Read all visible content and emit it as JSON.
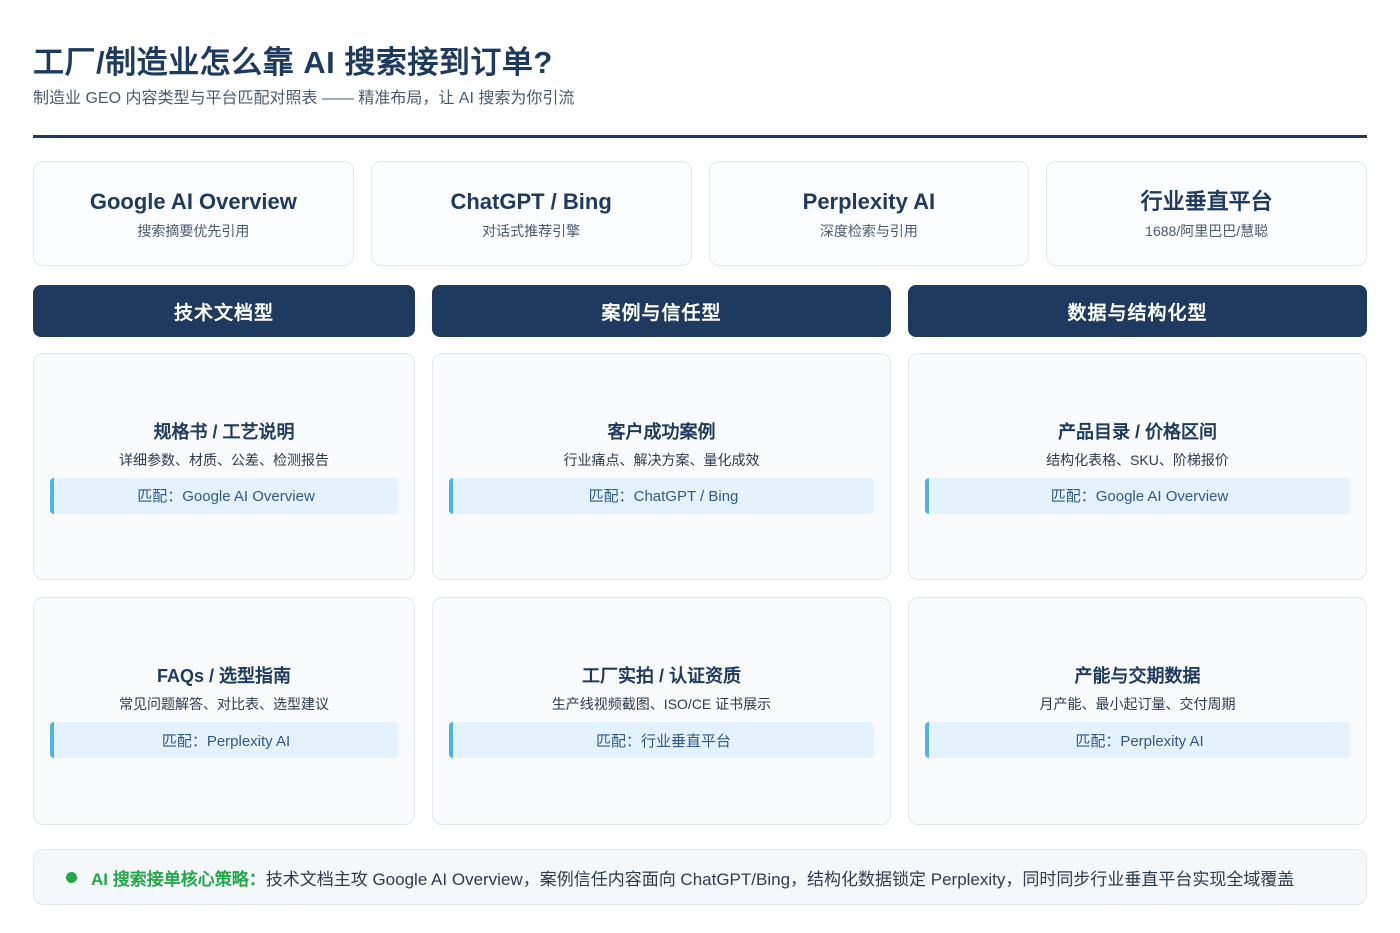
{
  "header": {
    "title": "工厂/制造业怎么靠 AI 搜索接到订单?",
    "subtitle": "制造业 GEO 内容类型与平台匹配对照表 —— 精准布局，让 AI 搜索为你引流"
  },
  "platforms": [
    {
      "name": "Google AI Overview",
      "desc": "搜索摘要优先引用"
    },
    {
      "name": "ChatGPT / Bing",
      "desc": "对话式推荐引擎"
    },
    {
      "name": "Perplexity AI",
      "desc": "深度检索与引用"
    },
    {
      "name": "行业垂直平台",
      "desc": "1688/阿里巴巴/慧聪"
    }
  ],
  "columns": [
    {
      "head": "技术文档型",
      "cards": [
        {
          "title": "规格书 / 工艺说明",
          "desc": "详细参数、材质、公差、检测报告",
          "match": "匹配：Google AI Overview"
        },
        {
          "title": "FAQs / 选型指南",
          "desc": "常见问题解答、对比表、选型建议",
          "match": "匹配：Perplexity AI"
        }
      ]
    },
    {
      "head": "案例与信任型",
      "cards": [
        {
          "title": "客户成功案例",
          "desc": "行业痛点、解决方案、量化成效",
          "match": "匹配：ChatGPT / Bing"
        },
        {
          "title": "工厂实拍 / 认证资质",
          "desc": "生产线视频截图、ISO/CE 证书展示",
          "match": "匹配：行业垂直平台"
        }
      ]
    },
    {
      "head": "数据与结构化型",
      "cards": [
        {
          "title": "产品目录 / 价格区间",
          "desc": "结构化表格、SKU、阶梯报价",
          "match": "匹配：Google AI Overview"
        },
        {
          "title": "产能与交期数据",
          "desc": "月产能、最小起订量、交付周期",
          "match": "匹配：Perplexity AI"
        }
      ]
    }
  ],
  "footer": {
    "label": "AI 搜索接单核心策略：",
    "text": "技术文档主攻 Google AI Overview，案例信任内容面向 ChatGPT/Bing，结构化数据锁定 Perplexity，同时同步行业垂直平台实现全域覆盖"
  },
  "colors": {
    "primary": "#1e3a5f",
    "accent": "#4fb3e8",
    "match_bg": "#e3f2fd",
    "success": "#22a84a"
  }
}
